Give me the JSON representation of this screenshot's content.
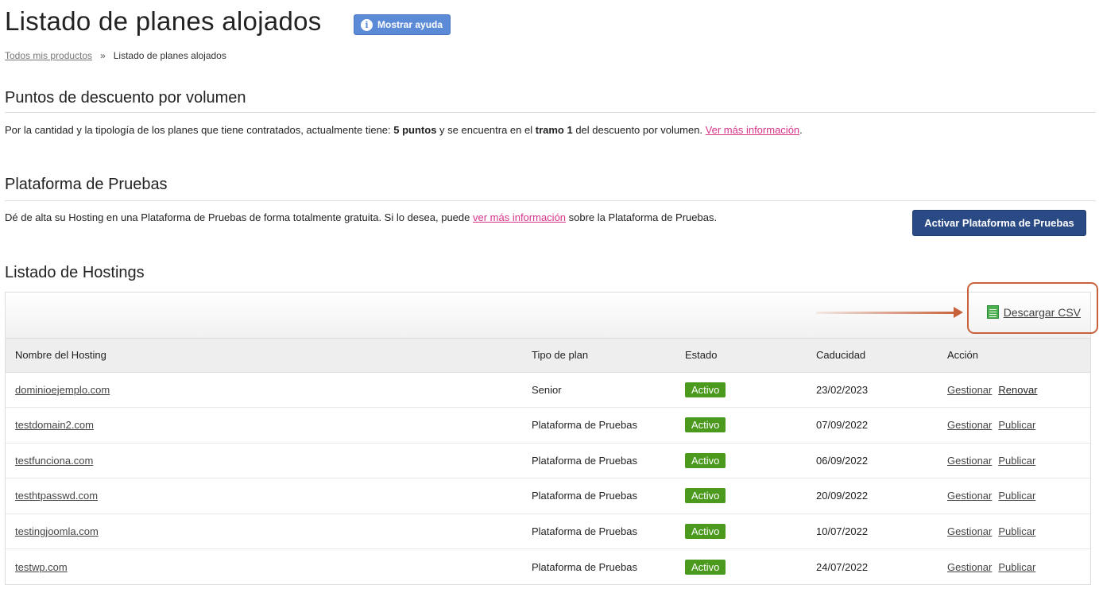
{
  "header": {
    "title": "Listado de planes alojados",
    "help_button_label": "Mostrar ayuda",
    "help_icon_glyph": "i"
  },
  "breadcrumb": {
    "root": "Todos mis productos",
    "separator": "»",
    "current": "Listado de planes alojados"
  },
  "volume_discount": {
    "title": "Puntos de descuento por volumen",
    "text_before": "Por la cantidad y la tipología de los planes que tiene contratados, actualmente tiene: ",
    "points": "5 puntos",
    "text_middle": " y se encuentra en el ",
    "tier": "tramo 1",
    "text_after": " del descuento por volumen. ",
    "link": "Ver más información",
    "trailing": "."
  },
  "test_platform": {
    "title": "Plataforma de Pruebas",
    "text_before": "Dé de alta su Hosting en una Plataforma de Pruebas de forma totalmente gratuita. Si lo desea, puede ",
    "link": "ver más información",
    "text_after": " sobre la Plataforma de Pruebas.",
    "button_label": "Activar Plataforma de Pruebas"
  },
  "hostings": {
    "title": "Listado de Hostings",
    "csv_label": "Descargar CSV",
    "columns": [
      "Nombre del Hosting",
      "Tipo de plan",
      "Estado",
      "Caducidad",
      "Acción"
    ],
    "rows": [
      {
        "name": "dominioejemplo.com",
        "plan": "Senior",
        "status": "Activo",
        "expiry": "23/02/2023",
        "action1": "Gestionar",
        "action2": "Renovar"
      },
      {
        "name": "testdomain2.com",
        "plan": "Plataforma de Pruebas",
        "status": "Activo",
        "expiry": "07/09/2022",
        "action1": "Gestionar",
        "action2": "Publicar"
      },
      {
        "name": "testfunciona.com",
        "plan": "Plataforma de Pruebas",
        "status": "Activo",
        "expiry": "06/09/2022",
        "action1": "Gestionar",
        "action2": "Publicar"
      },
      {
        "name": "testhtpasswd.com",
        "plan": "Plataforma de Pruebas",
        "status": "Activo",
        "expiry": "20/09/2022",
        "action1": "Gestionar",
        "action2": "Publicar"
      },
      {
        "name": "testingjoomla.com",
        "plan": "Plataforma de Pruebas",
        "status": "Activo",
        "expiry": "10/07/2022",
        "action1": "Gestionar",
        "action2": "Publicar"
      },
      {
        "name": "testwp.com",
        "plan": "Plataforma de Pruebas",
        "status": "Activo",
        "expiry": "24/07/2022",
        "action1": "Gestionar",
        "action2": "Publicar"
      }
    ]
  },
  "colors": {
    "help_button": "#5b8ad6",
    "primary_button": "#2a4a86",
    "status_active": "#4b9a1e",
    "link_pink": "#d6338a",
    "annotation": "#c8623b"
  }
}
